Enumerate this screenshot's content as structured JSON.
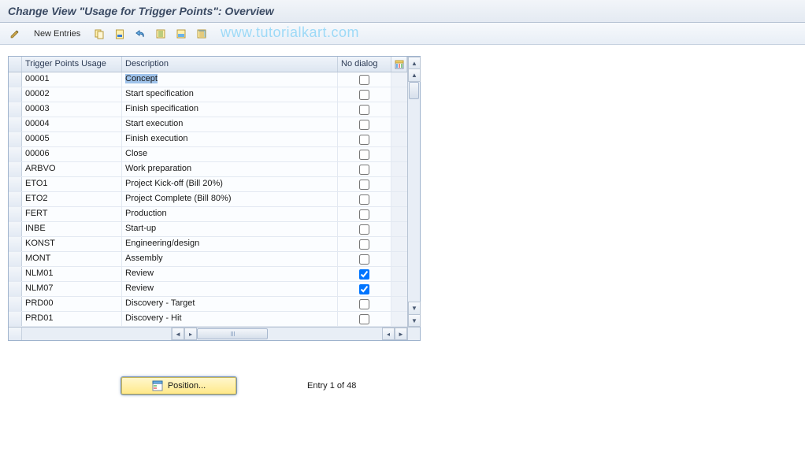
{
  "title": "Change View \"Usage for Trigger Points\": Overview",
  "toolbar": {
    "new_entries_label": "New Entries"
  },
  "watermark": "www.tutorialkart.com",
  "grid": {
    "headers": {
      "usage": "Trigger Points Usage",
      "description": "Description",
      "no_dialog": "No dialog"
    },
    "rows": [
      {
        "usage": "00001",
        "description": "Concept",
        "no_dialog": false,
        "selected": true
      },
      {
        "usage": "00002",
        "description": "Start specification",
        "no_dialog": false
      },
      {
        "usage": "00003",
        "description": "Finish specification",
        "no_dialog": false
      },
      {
        "usage": "00004",
        "description": "Start execution",
        "no_dialog": false
      },
      {
        "usage": "00005",
        "description": "Finish execution",
        "no_dialog": false
      },
      {
        "usage": "00006",
        "description": "Close",
        "no_dialog": false
      },
      {
        "usage": "ARBVO",
        "description": "Work preparation",
        "no_dialog": false
      },
      {
        "usage": "ETO1",
        "description": "Project Kick-off (Bill 20%)",
        "no_dialog": false
      },
      {
        "usage": "ETO2",
        "description": "Project Complete (Bill 80%)",
        "no_dialog": false
      },
      {
        "usage": "FERT",
        "description": "Production",
        "no_dialog": false
      },
      {
        "usage": "INBE",
        "description": "Start-up",
        "no_dialog": false
      },
      {
        "usage": "KONST",
        "description": "Engineering/design",
        "no_dialog": false
      },
      {
        "usage": "MONT",
        "description": "Assembly",
        "no_dialog": false
      },
      {
        "usage": "NLM01",
        "description": "Review",
        "no_dialog": true
      },
      {
        "usage": "NLM07",
        "description": "Review",
        "no_dialog": true
      },
      {
        "usage": "PRD00",
        "description": "Discovery - Target",
        "no_dialog": false
      },
      {
        "usage": "PRD01",
        "description": "Discovery - Hit",
        "no_dialog": false
      }
    ]
  },
  "footer": {
    "position_label": "Position...",
    "entry_info": "Entry 1 of 48"
  }
}
